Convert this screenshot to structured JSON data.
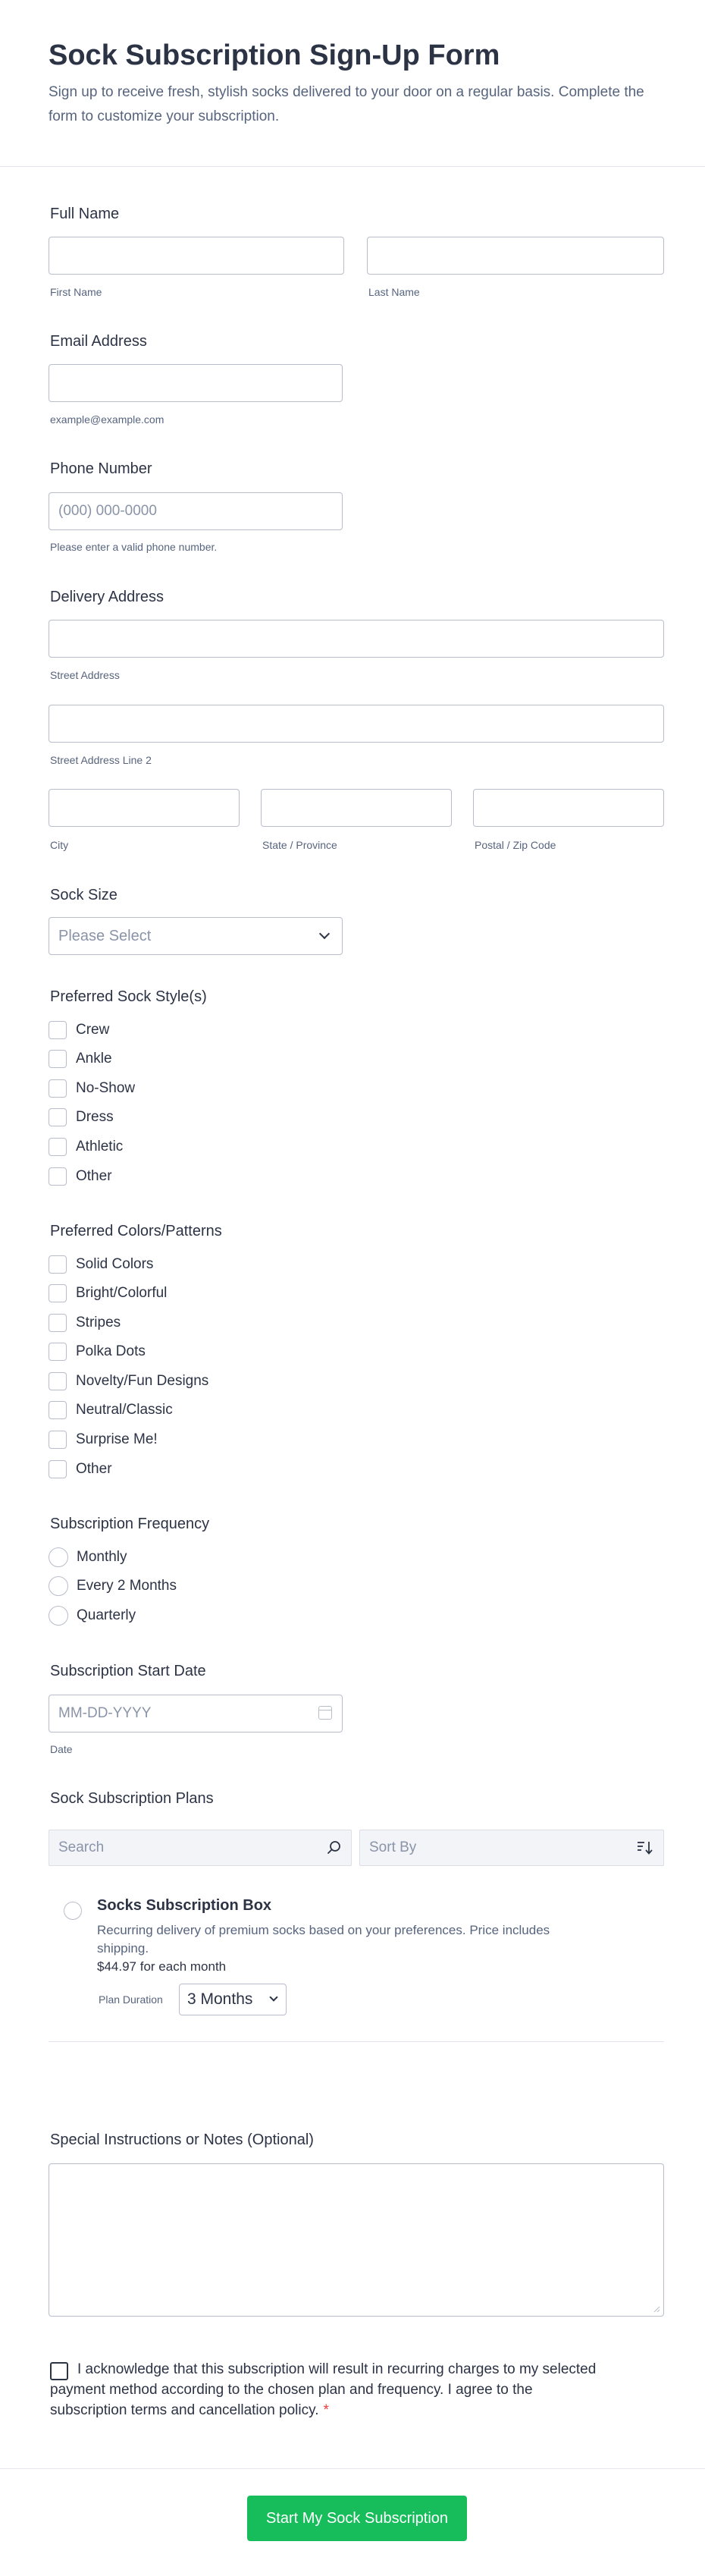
{
  "header": {
    "title": "Sock Subscription Sign-Up Form",
    "subtitle": "Sign up to receive fresh, stylish socks delivered to your door on a regular basis. Complete the form to customize your subscription."
  },
  "full_name": {
    "label": "Full Name",
    "first_sublabel": "First Name",
    "last_sublabel": "Last Name",
    "first_value": "",
    "last_value": ""
  },
  "email": {
    "label": "Email Address",
    "sublabel": "example@example.com",
    "value": ""
  },
  "phone": {
    "label": "Phone Number",
    "placeholder": "(000) 000-0000",
    "sublabel": "Please enter a valid phone number."
  },
  "address": {
    "label": "Delivery Address",
    "street_sublabel": "Street Address",
    "street2_sublabel": "Street Address Line 2",
    "city_sublabel": "City",
    "state_sublabel": "State / Province",
    "zip_sublabel": "Postal / Zip Code"
  },
  "sock_size": {
    "label": "Sock Size",
    "selected": "Please Select"
  },
  "styles": {
    "label": "Preferred Sock Style(s)",
    "options": [
      "Crew",
      "Ankle",
      "No-Show",
      "Dress",
      "Athletic",
      "Other"
    ]
  },
  "colors": {
    "label": "Preferred Colors/Patterns",
    "options": [
      "Solid Colors",
      "Bright/Colorful",
      "Stripes",
      "Polka Dots",
      "Novelty/Fun Designs",
      "Neutral/Classic",
      "Surprise Me!",
      "Other"
    ]
  },
  "frequency": {
    "label": "Subscription Frequency",
    "options": [
      "Monthly",
      "Every 2 Months",
      "Quarterly"
    ]
  },
  "start_date": {
    "label": "Subscription Start Date",
    "placeholder": "MM-DD-YYYY",
    "sublabel": "Date"
  },
  "plans": {
    "label": "Sock Subscription Plans",
    "search_placeholder": "Search",
    "sort_label": "Sort By",
    "product": {
      "title": "Socks Subscription Box",
      "description": "Recurring delivery of premium socks based on your preferences. Price includes shipping.",
      "price": "$44.97",
      "price_suffix": " for each month",
      "duration_label": "Plan Duration",
      "duration_value": "3 Months"
    }
  },
  "notes": {
    "label": "Special Instructions or Notes (Optional)"
  },
  "acknowledge": {
    "text": "I acknowledge that this subscription will result in recurring charges to my selected payment method according to the chosen plan and frequency. I agree to the subscription terms and cancellation policy.",
    "required_mark": "*"
  },
  "submit": {
    "label": "Start My Sock Subscription"
  },
  "colors_theme": {
    "primary_text": "#2c3345",
    "secondary_text": "#57647e",
    "border": "#b8bdc9",
    "submit_bg": "#18bd5b",
    "required": "#f23a3c"
  }
}
